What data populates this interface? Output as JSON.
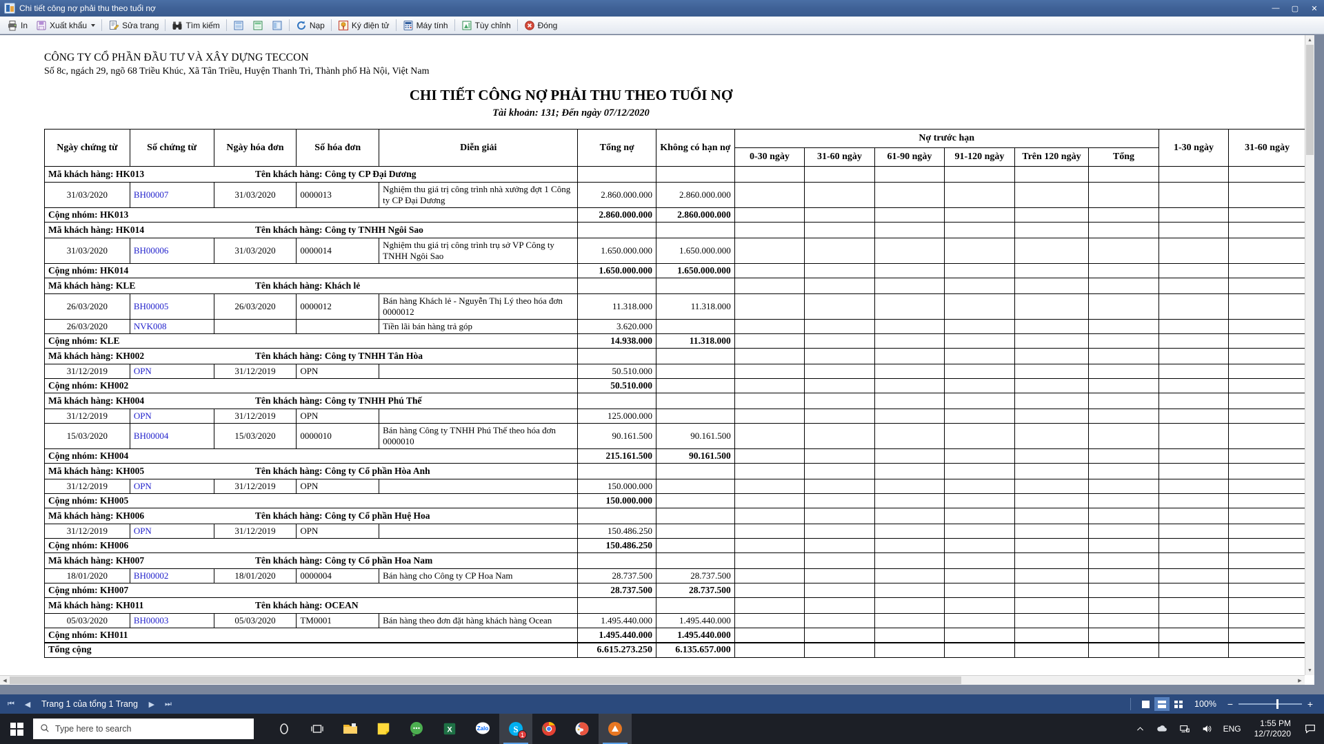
{
  "window": {
    "title": "Chi tiết công nợ phải thu theo tuổi nợ",
    "app_icon": "report-icon",
    "minimize": "—",
    "maximize": "▢",
    "close": "✕"
  },
  "toolbar": {
    "items": [
      {
        "label": "In",
        "icon": "printer-icon",
        "dropdown": false
      },
      {
        "label": "Xuất khẩu",
        "icon": "export-icon",
        "dropdown": true
      },
      {
        "label": "Sửa trang",
        "icon": "page-edit-icon",
        "dropdown": false
      },
      {
        "label": "Tìm kiếm",
        "icon": "binoculars-icon",
        "dropdown": false
      },
      {
        "label": "",
        "icon": "view-single-page-icon",
        "dropdown": false
      },
      {
        "label": "",
        "icon": "view-continuous-icon",
        "dropdown": false
      },
      {
        "label": "",
        "icon": "view-facing-icon",
        "dropdown": false
      },
      {
        "label": "Nạp",
        "icon": "refresh-icon",
        "dropdown": false
      },
      {
        "label": "Ký điện tử",
        "icon": "digital-signature-icon",
        "dropdown": false
      },
      {
        "label": "Máy tính",
        "icon": "calculator-icon",
        "dropdown": false
      },
      {
        "label": "Tùy chỉnh",
        "icon": "customize-icon",
        "dropdown": false
      },
      {
        "label": "Đóng",
        "icon": "close-circle-icon",
        "dropdown": false
      }
    ]
  },
  "report": {
    "company_name": "CÔNG TY CỔ PHẦN ĐẦU TƯ VÀ XÂY DỰNG TECCON",
    "company_address": "Số 8c, ngách 29, ngõ 68 Triều Khúc, Xã Tân Triều, Huyện Thanh Trì, Thành phố Hà Nội, Việt Nam",
    "title": "CHI TIẾT CÔNG NỢ PHẢI THU THEO TUỔI NỢ",
    "subtitle": "Tài khoản: 131; Đến ngày 07/12/2020",
    "headers": {
      "doc_date": "Ngày chứng từ",
      "doc_no": "Số chứng từ",
      "inv_date": "Ngày hóa đơn",
      "inv_no": "Số hóa đơn",
      "description": "Diễn giải",
      "total_debt": "Tổng nợ",
      "no_term_debt": "Không có hạn nợ",
      "pre_due_group": "Nợ trước hạn",
      "d0_30": "0-30 ngày",
      "d31_60": "31-60 ngày",
      "d61_90": "61-90 ngày",
      "d91_120": "91-120 ngày",
      "d_over120": "Trên 120 ngày",
      "subtotal": "Tổng",
      "o1_30": "1-30 ngày",
      "o31_60": "31-60 ngày"
    },
    "customer_code_label": "Mã khách hàng:",
    "customer_name_label": "Tên khách hàng:",
    "group_sum_label": "Cộng nhóm:",
    "grand_total_label": "Tổng cộng",
    "groups": [
      {
        "code": "HK013",
        "name": "Công ty CP Đại Dương",
        "rows": [
          {
            "doc_date": "31/03/2020",
            "doc_no": "BH00007",
            "inv_date": "31/03/2020",
            "inv_no": "0000013",
            "description": "Nghiệm thu giá trị công trình nhà xưởng đợt 1 Công ty CP Đại Dương",
            "total_debt": "2.860.000.000",
            "no_term_debt": "2.860.000.000"
          }
        ],
        "sum": {
          "total_debt": "2.860.000.000",
          "no_term_debt": "2.860.000.000"
        }
      },
      {
        "code": "HK014",
        "name": "Công ty TNHH Ngôi Sao",
        "rows": [
          {
            "doc_date": "31/03/2020",
            "doc_no": "BH00006",
            "inv_date": "31/03/2020",
            "inv_no": "0000014",
            "description": "Nghiệm thu giá trị công trình trụ sở VP Công ty TNHH Ngôi Sao",
            "total_debt": "1.650.000.000",
            "no_term_debt": "1.650.000.000"
          }
        ],
        "sum": {
          "total_debt": "1.650.000.000",
          "no_term_debt": "1.650.000.000"
        }
      },
      {
        "code": "KLE",
        "name": "Khách lẻ",
        "rows": [
          {
            "doc_date": "26/03/2020",
            "doc_no": "BH00005",
            "inv_date": "26/03/2020",
            "inv_no": "0000012",
            "description": "Bán hàng Khách lẻ - Nguyễn Thị Lý theo hóa đơn 0000012",
            "total_debt": "11.318.000",
            "no_term_debt": "11.318.000"
          },
          {
            "doc_date": "26/03/2020",
            "doc_no": "NVK008",
            "inv_date": "",
            "inv_no": "",
            "description": "Tiền lãi bán hàng trả góp",
            "total_debt": "3.620.000",
            "no_term_debt": ""
          }
        ],
        "sum": {
          "total_debt": "14.938.000",
          "no_term_debt": "11.318.000"
        }
      },
      {
        "code": "KH002",
        "name": "Công ty TNHH Tân Hòa",
        "rows": [
          {
            "doc_date": "31/12/2019",
            "doc_no": "OPN",
            "inv_date": "31/12/2019",
            "inv_no": "OPN",
            "description": "",
            "total_debt": "50.510.000",
            "no_term_debt": ""
          }
        ],
        "sum": {
          "total_debt": "50.510.000",
          "no_term_debt": ""
        }
      },
      {
        "code": "KH004",
        "name": "Công ty TNHH Phú Thế",
        "rows": [
          {
            "doc_date": "31/12/2019",
            "doc_no": "OPN",
            "inv_date": "31/12/2019",
            "inv_no": "OPN",
            "description": "",
            "total_debt": "125.000.000",
            "no_term_debt": ""
          },
          {
            "doc_date": "15/03/2020",
            "doc_no": "BH00004",
            "inv_date": "15/03/2020",
            "inv_no": "0000010",
            "description": "Bán hàng Công ty TNHH Phú Thế theo hóa đơn 0000010",
            "total_debt": "90.161.500",
            "no_term_debt": "90.161.500"
          }
        ],
        "sum": {
          "total_debt": "215.161.500",
          "no_term_debt": "90.161.500"
        }
      },
      {
        "code": "KH005",
        "name": "Công ty Cổ phần Hòa Anh",
        "rows": [
          {
            "doc_date": "31/12/2019",
            "doc_no": "OPN",
            "inv_date": "31/12/2019",
            "inv_no": "OPN",
            "description": "",
            "total_debt": "150.000.000",
            "no_term_debt": ""
          }
        ],
        "sum": {
          "total_debt": "150.000.000",
          "no_term_debt": ""
        }
      },
      {
        "code": "KH006",
        "name": "Công ty Cổ phần Huệ Hoa",
        "rows": [
          {
            "doc_date": "31/12/2019",
            "doc_no": "OPN",
            "inv_date": "31/12/2019",
            "inv_no": "OPN",
            "description": "",
            "total_debt": "150.486.250",
            "no_term_debt": ""
          }
        ],
        "sum": {
          "total_debt": "150.486.250",
          "no_term_debt": ""
        }
      },
      {
        "code": "KH007",
        "name": "Công ty Cổ phần Hoa Nam",
        "rows": [
          {
            "doc_date": "18/01/2020",
            "doc_no": "BH00002",
            "inv_date": "18/01/2020",
            "inv_no": "0000004",
            "description": "Bán hàng cho Công ty CP Hoa Nam",
            "total_debt": "28.737.500",
            "no_term_debt": "28.737.500"
          }
        ],
        "sum": {
          "total_debt": "28.737.500",
          "no_term_debt": "28.737.500"
        }
      },
      {
        "code": "KH011",
        "name": "OCEAN",
        "rows": [
          {
            "doc_date": "05/03/2020",
            "doc_no": "BH00003",
            "inv_date": "05/03/2020",
            "inv_no": "TM0001",
            "description": "Bán hàng theo đơn đặt hàng khách hàng Ocean",
            "total_debt": "1.495.440.000",
            "no_term_debt": "1.495.440.000"
          }
        ],
        "sum": {
          "total_debt": "1.495.440.000",
          "no_term_debt": "1.495.440.000"
        }
      }
    ],
    "grand_total": {
      "total_debt": "6.615.273.250",
      "no_term_debt": "6.135.657.000"
    }
  },
  "statusbar": {
    "first_page": "⏮",
    "prev_page": "◀",
    "page_text": "Trang 1 của tổng 1 Trang",
    "next_page": "▶",
    "last_page": "⏭",
    "zoom_level": "100%",
    "zoom_out": "−",
    "zoom_in": "+",
    "view_modes": [
      "single-page-view",
      "continuous-view",
      "grid-view"
    ],
    "active_view": 1
  },
  "taskbar": {
    "start": "windows-start",
    "search_placeholder": "Type here to search",
    "apps": [
      {
        "name": "cortana-icon",
        "active": false,
        "badge": ""
      },
      {
        "name": "task-view-icon",
        "active": false,
        "badge": ""
      },
      {
        "name": "file-explorer-icon",
        "active": false,
        "badge": ""
      },
      {
        "name": "sticky-notes-icon",
        "active": false,
        "badge": ""
      },
      {
        "name": "messenger-icon",
        "active": false,
        "badge": ""
      },
      {
        "name": "excel-icon",
        "active": false,
        "badge": ""
      },
      {
        "name": "zalo-icon",
        "active": false,
        "badge": ""
      },
      {
        "name": "skype-icon",
        "active": true,
        "badge": "1"
      },
      {
        "name": "chrome-icon",
        "active": false,
        "badge": ""
      },
      {
        "name": "paint-icon",
        "active": false,
        "badge": ""
      },
      {
        "name": "accounting-app-icon",
        "active": true,
        "badge": ""
      }
    ],
    "tray": {
      "chevron": "show-hidden-icons",
      "onedrive": "onedrive-icon",
      "network": "network-icon",
      "volume": "volume-icon",
      "language": "ENG",
      "time": "1:55 PM",
      "date": "12/7/2020",
      "action_center": "action-center-icon"
    }
  }
}
